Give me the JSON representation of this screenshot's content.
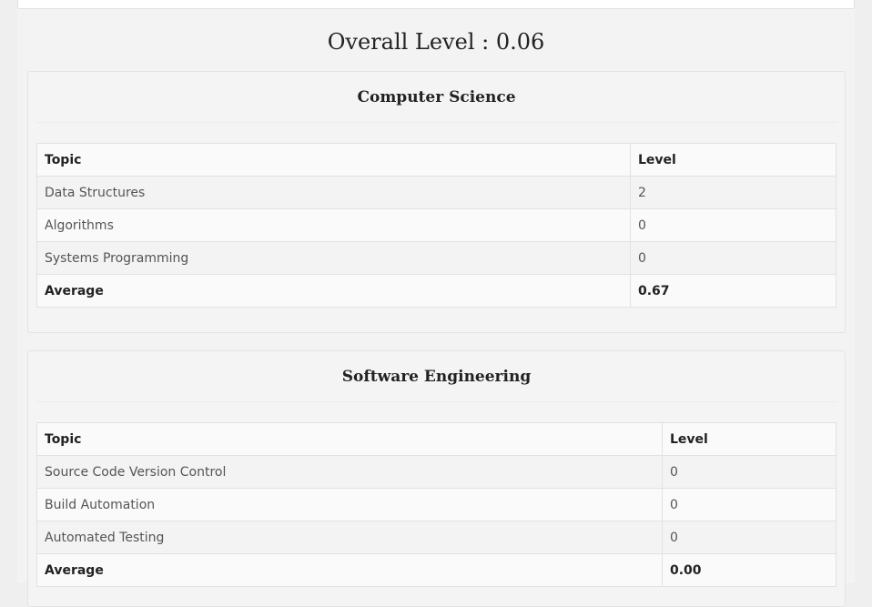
{
  "overall": {
    "label": "Overall Level : 0.06"
  },
  "sections": [
    {
      "title": "Computer Science",
      "headers": {
        "topic": "Topic",
        "level": "Level"
      },
      "rows": [
        {
          "topic": "Data Structures",
          "level": "2"
        },
        {
          "topic": "Algorithms",
          "level": "0"
        },
        {
          "topic": "Systems Programming",
          "level": "0"
        }
      ],
      "average": {
        "label": "Average",
        "value": "0.67"
      }
    },
    {
      "title": "Software Engineering",
      "headers": {
        "topic": "Topic",
        "level": "Level"
      },
      "rows": [
        {
          "topic": "Source Code Version Control",
          "level": "0"
        },
        {
          "topic": "Build Automation",
          "level": "0"
        },
        {
          "topic": "Automated Testing",
          "level": "0"
        }
      ],
      "average": {
        "label": "Average",
        "value": "0.00"
      }
    }
  ]
}
